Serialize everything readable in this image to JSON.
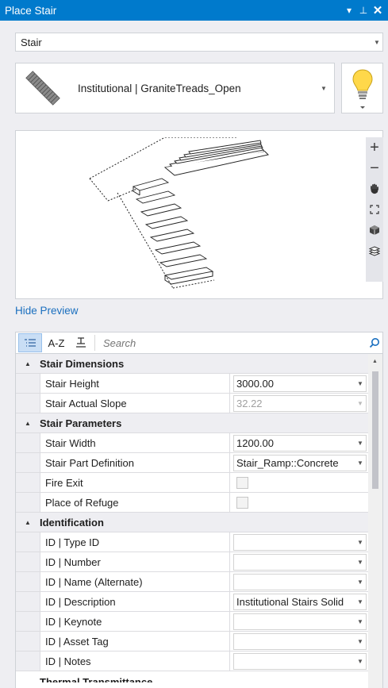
{
  "window": {
    "title": "Place Stair",
    "pin_glyph": "▾ ⊥",
    "close_glyph": "✕"
  },
  "family_combo": {
    "value": "Stair"
  },
  "type_combo": {
    "value": "Institutional | GraniteTreads_Open"
  },
  "preview": {
    "toolbar_icons": [
      "zoom-in-icon",
      "zoom-out-icon",
      "pan-hand-icon",
      "fit-view-icon",
      "view-cube-icon",
      "layers-icon"
    ],
    "zoom_in_glyph": "+",
    "zoom_out_glyph": "−",
    "hide_label": "Hide Preview"
  },
  "properties": {
    "toolbar": {
      "az_label": "A-Z",
      "search_placeholder": "Search"
    },
    "categories": [
      {
        "title": "Stair Dimensions",
        "rows": [
          {
            "name": "Stair Height",
            "value": "3000.00",
            "type": "combo",
            "disabled": false
          },
          {
            "name": "Stair Actual Slope",
            "value": "32.22",
            "type": "combo",
            "disabled": true
          }
        ]
      },
      {
        "title": "Stair Parameters",
        "rows": [
          {
            "name": "Stair Width",
            "value": "1200.00",
            "type": "combo",
            "disabled": false
          },
          {
            "name": "Stair Part Definition",
            "value": "Stair_Ramp::Concrete",
            "type": "combo",
            "disabled": false
          },
          {
            "name": "Fire Exit",
            "value": "",
            "type": "checkbox",
            "disabled": true
          },
          {
            "name": "Place of Refuge",
            "value": "",
            "type": "checkbox",
            "disabled": true
          }
        ]
      },
      {
        "title": "Identification",
        "rows": [
          {
            "name": "ID | Type ID",
            "value": "",
            "type": "combo",
            "disabled": false
          },
          {
            "name": "ID | Number",
            "value": "",
            "type": "combo",
            "disabled": false
          },
          {
            "name": "ID | Name (Alternate)",
            "value": "",
            "type": "combo",
            "disabled": false
          },
          {
            "name": "ID | Description",
            "value": "Institutional Stairs Solid",
            "type": "combo",
            "disabled": false
          },
          {
            "name": "ID | Keynote",
            "value": "",
            "type": "combo",
            "disabled": false
          },
          {
            "name": "ID | Asset Tag",
            "value": "",
            "type": "combo",
            "disabled": false
          },
          {
            "name": "ID | Notes",
            "value": "",
            "type": "combo",
            "disabled": false
          }
        ]
      }
    ],
    "partial_category": "Thermal Transmittance"
  },
  "colors": {
    "titlebar": "#007acc",
    "link": "#1a6fbf",
    "panel_bg": "#eeeef2"
  }
}
